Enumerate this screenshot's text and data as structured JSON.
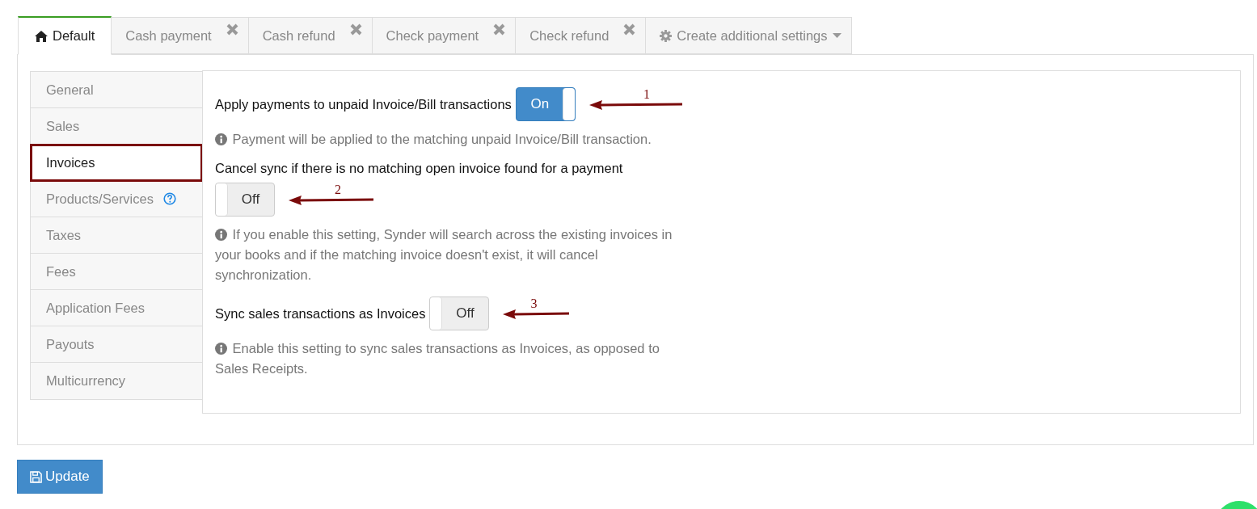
{
  "tabs": [
    {
      "label": "Default",
      "selected": true,
      "kind": "home"
    },
    {
      "label": "Cash payment",
      "selected": false,
      "kind": "closable"
    },
    {
      "label": "Cash refund",
      "selected": false,
      "kind": "closable"
    },
    {
      "label": "Check payment",
      "selected": false,
      "kind": "closable"
    },
    {
      "label": "Check refund",
      "selected": false,
      "kind": "closable"
    },
    {
      "label": "Create additional settings",
      "selected": false,
      "kind": "dropdown"
    }
  ],
  "sidebar": {
    "items": [
      {
        "label": "General",
        "selected": false,
        "annotated": false,
        "help": false
      },
      {
        "label": "Sales",
        "selected": false,
        "annotated": false,
        "help": false
      },
      {
        "label": "Invoices",
        "selected": true,
        "annotated": true,
        "help": false
      },
      {
        "label": "Products/Services",
        "selected": false,
        "annotated": false,
        "help": true
      },
      {
        "label": "Taxes",
        "selected": false,
        "annotated": false,
        "help": false
      },
      {
        "label": "Fees",
        "selected": false,
        "annotated": false,
        "help": false
      },
      {
        "label": "Application Fees",
        "selected": false,
        "annotated": false,
        "help": false
      },
      {
        "label": "Payouts",
        "selected": false,
        "annotated": false,
        "help": false
      },
      {
        "label": "Multicurrency",
        "selected": false,
        "annotated": false,
        "help": false
      }
    ]
  },
  "settings": [
    {
      "kind": "inline",
      "label": "Apply payments to unpaid Invoice/Bill transactions",
      "on": true,
      "toggle_text": "On",
      "annotation": "1",
      "hint": "Payment will be applied to the matching unpaid Invoice/Bill transaction."
    },
    {
      "kind": "stacked",
      "label": "Cancel sync if there is no matching open invoice found for a payment",
      "on": false,
      "toggle_text": "Off",
      "annotation": "2",
      "hint": "If you enable this setting, Synder will search across the existing invoices in your books and if the matching invoice doesn't exist, it will cancel synchronization."
    },
    {
      "kind": "inline",
      "label": "Sync sales transactions as Invoices",
      "on": false,
      "toggle_text": "Off",
      "annotation": "3",
      "hint": "Enable this setting to sync sales transactions as Invoices, as opposed to Sales Receipts."
    }
  ],
  "update_button": {
    "label": "Update"
  }
}
